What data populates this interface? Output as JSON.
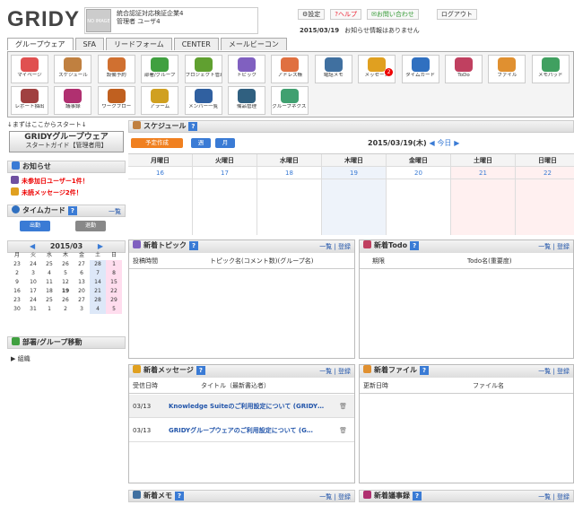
{
  "header": {
    "logo": "GRIDY",
    "avatar_text": "NO IMAGE",
    "org_name": "統合認証対応検証企業4",
    "user_name": "管理者 ユーザ4",
    "settings": "設定",
    "help": "ヘルプ",
    "inquiry": "お問い合わせ",
    "logout": "ログアウト",
    "date": "2015/03/19",
    "notice": "お知らせ情報はありません"
  },
  "tabs": [
    "グループウェア",
    "SFA",
    "リードフォーム",
    "CENTER",
    "メールビーコン"
  ],
  "icons": [
    {
      "label": "マイページ",
      "color": "#e05050"
    },
    {
      "label": "スケジュール",
      "color": "#c08040"
    },
    {
      "label": "設備予約",
      "color": "#d07030"
    },
    {
      "label": "部署/グループ",
      "color": "#40a040"
    },
    {
      "label": "プロジェクト管理",
      "color": "#60a030"
    },
    {
      "label": "トピック",
      "color": "#8060c0"
    },
    {
      "label": "アドレス帳",
      "color": "#e07040"
    },
    {
      "label": "電話メモ",
      "color": "#4070a0"
    },
    {
      "label": "メッセージ",
      "color": "#e0a020"
    },
    {
      "label": "タイムカード",
      "color": "#3070c0"
    },
    {
      "label": "ToDo",
      "color": "#c04060"
    },
    {
      "label": "ファイル",
      "color": "#e09030"
    },
    {
      "label": "メモパッド",
      "color": "#40a060"
    },
    {
      "label": "レポート抽出",
      "color": "#a04040"
    },
    {
      "label": "議事録",
      "color": "#b03070"
    },
    {
      "label": "ワークフロー",
      "color": "#c06020"
    },
    {
      "label": "アラーム",
      "color": "#d0a020"
    },
    {
      "label": "メンバー一覧",
      "color": "#3060a0"
    },
    {
      "label": "備品管理",
      "color": "#306080"
    },
    {
      "label": "グループネクスト",
      "color": "#40a070"
    }
  ],
  "message_badge": "2",
  "sidebar": {
    "hint": "↓まずはここからスタート↓",
    "guide_title": "GRIDYグループウェア",
    "guide_sub": "スタートガイド【管理者用】",
    "news_title": "お知らせ",
    "alert1": "未参加日ユーザー1件！",
    "alert2": "未読メッセージ2件！",
    "timecard_title": "タイムカード",
    "timecard_link": "一覧",
    "clock_in": "出勤",
    "clock_out": "退勤",
    "cal_month": "2015/03",
    "dept_title": "部署/グループ移動",
    "dept_item": "組織"
  },
  "calendar": {
    "weekdays": [
      "月",
      "火",
      "水",
      "木",
      "金",
      "土",
      "日"
    ],
    "weeks": [
      [
        "23",
        "24",
        "25",
        "26",
        "27",
        "28",
        "1"
      ],
      [
        "2",
        "3",
        "4",
        "5",
        "6",
        "7",
        "8"
      ],
      [
        "9",
        "10",
        "11",
        "12",
        "13",
        "14",
        "15"
      ],
      [
        "16",
        "17",
        "18",
        "19",
        "20",
        "21",
        "22"
      ],
      [
        "23",
        "24",
        "25",
        "26",
        "27",
        "28",
        "29"
      ],
      [
        "30",
        "31",
        "1",
        "2",
        "3",
        "4",
        "5"
      ]
    ]
  },
  "schedule": {
    "title": "スケジュール",
    "new_btn": "予定作成",
    "week_btn": "週",
    "month_btn": "月",
    "date_label": "2015/03/19(木)",
    "today": "今日",
    "days": [
      {
        "wd": "月曜日",
        "d": "16"
      },
      {
        "wd": "火曜日",
        "d": "17"
      },
      {
        "wd": "水曜日",
        "d": "18"
      },
      {
        "wd": "木曜日",
        "d": "19"
      },
      {
        "wd": "金曜日",
        "d": "20"
      },
      {
        "wd": "土曜日",
        "d": "21"
      },
      {
        "wd": "日曜日",
        "d": "22"
      }
    ]
  },
  "panels": {
    "list": "一覧",
    "reg": "登録",
    "topic_title": "新着トピック",
    "topic_col1": "投稿時間",
    "topic_col2": "トピック名(コメント数)(グループ名)",
    "todo_title": "新着Todo",
    "todo_col1": "期限",
    "todo_col2": "Todo名(重要度)",
    "msg_title": "新着メッセージ",
    "msg_col1": "受信日時",
    "msg_col2": "タイトル（最新書込者）",
    "file_title": "新着ファイル",
    "file_col1": "更新日時",
    "file_col2": "ファイル名",
    "memo_title": "新着メモ",
    "minutes_title": "新着議事録"
  },
  "messages": [
    {
      "date": "03/13",
      "title": "Knowledge Suiteのご利用設定について (GRIDY…"
    },
    {
      "date": "03/13",
      "title": "GRIDYグループウェアのご利用設定について (G…"
    }
  ],
  "colors": {
    "accent": "#3a7bd5",
    "alert": "#e00000"
  }
}
